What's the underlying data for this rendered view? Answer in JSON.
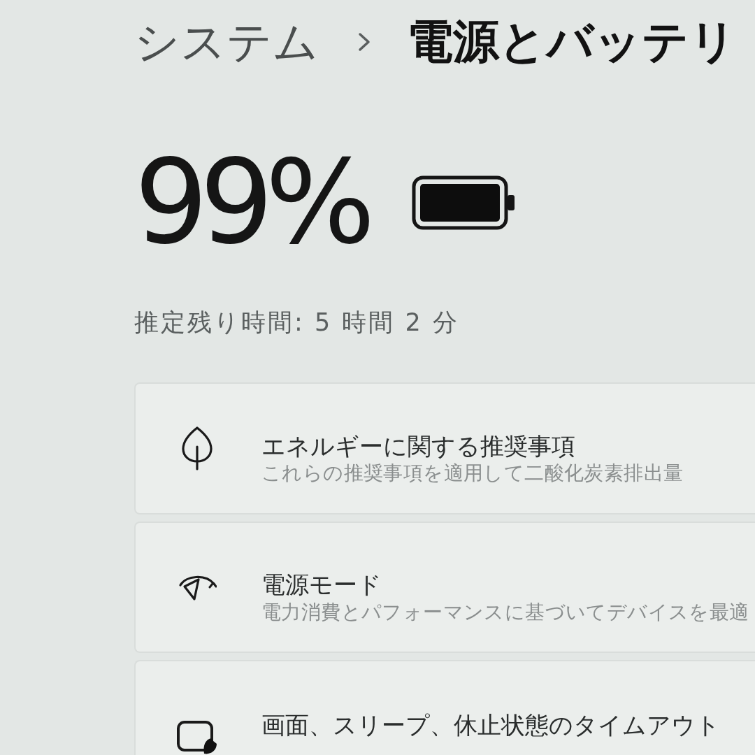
{
  "breadcrumb": [
    {
      "label": "システム"
    },
    {
      "label": "電源とバッテリ"
    }
  ],
  "battery": {
    "percent": "99%",
    "remaining": "推定残り時間: 5 時間 2 分"
  },
  "cards": [
    {
      "title": "エネルギーに関する推奨事項",
      "description": "これらの推奨事項を適用して二酸化炭素排出量"
    },
    {
      "title": "電源モード",
      "description": "電力消費とパフォーマンスに基づいてデバイスを最適"
    },
    {
      "title": "画面、スリープ、休止状態のタイムアウト"
    }
  ]
}
